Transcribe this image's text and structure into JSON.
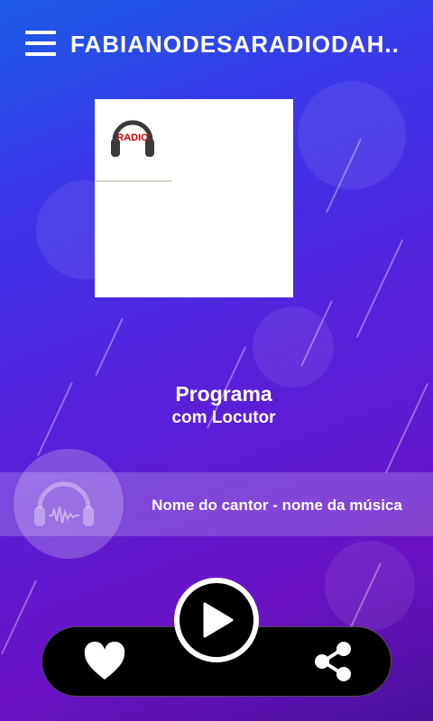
{
  "header": {
    "title": "FABIANODESARADIODAH..",
    "menu_icon": "hamburger-menu-icon"
  },
  "cover": {
    "logo_text": "RADIO",
    "logo_icon": "headphones-icon"
  },
  "program": {
    "name": "Programa",
    "host": "com Locutor"
  },
  "track": {
    "now_playing": "Nome do cantor - nome da música",
    "icon": "headphones-soundwave-icon"
  },
  "controls": {
    "like_icon": "heart-icon",
    "play_icon": "play-icon",
    "share_icon": "share-icon"
  },
  "colors": {
    "bg_top": "#1b5be6",
    "bg_mid": "#5a1fd8",
    "bg_bottom": "#4a0f9a",
    "controls_bg": "#000000",
    "text": "#ffffff",
    "logo_red": "#cc0000"
  }
}
